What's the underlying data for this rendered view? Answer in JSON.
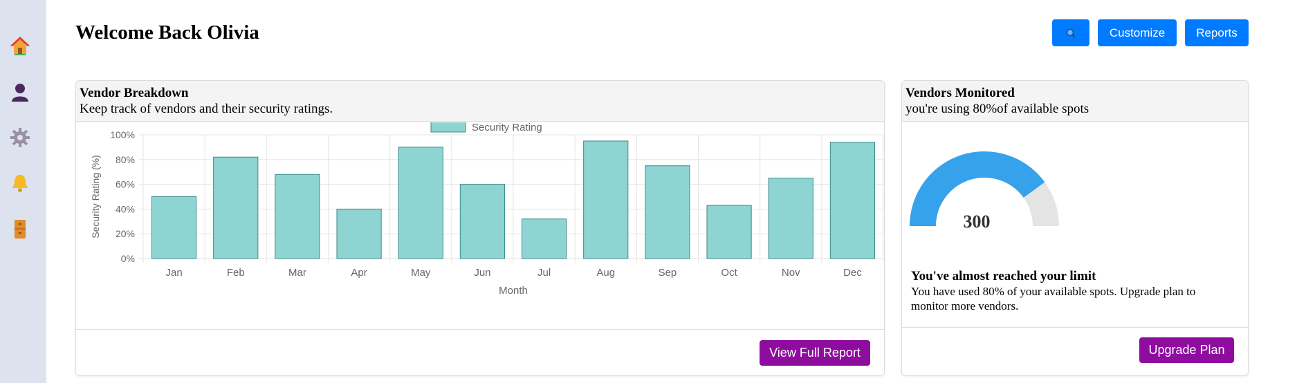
{
  "sidebar": {
    "items": [
      {
        "icon": "home-icon",
        "label": "Home"
      },
      {
        "icon": "user-icon",
        "label": "Profile"
      },
      {
        "icon": "gear-icon",
        "label": "Settings"
      },
      {
        "icon": "bell-icon",
        "label": "Notifications"
      },
      {
        "icon": "cabinet-icon",
        "label": "Archive"
      }
    ]
  },
  "header": {
    "title": "Welcome Back Olivia",
    "search_icon": "search-icon",
    "customize_label": "Customize",
    "reports_label": "Reports"
  },
  "vendor_card": {
    "title": "Vendor Breakdown",
    "subtitle": "Keep track of vendors and their security ratings.",
    "button_label": "View Full Report"
  },
  "monitor_card": {
    "title": "Vendors Monitored",
    "subtitle": "you're using 80%of available spots",
    "gauge_value": "300",
    "gauge_fraction": 0.8,
    "limit_title": "You've almost reached your limit",
    "limit_text": "You have used 80% of your available spots. Upgrade plan to monitor more vendors.",
    "button_label": "Upgrade Plan"
  },
  "colors": {
    "primary": "#007bff",
    "purple": "#8e0d9e",
    "bar_fill": "#8dd4d3",
    "bar_stroke": "#3f8a8a",
    "gauge_fill": "#36a2eb",
    "gauge_track": "#e4e4e4"
  },
  "chart_data": {
    "type": "bar",
    "categories": [
      "Jan",
      "Feb",
      "Mar",
      "Apr",
      "May",
      "Jun",
      "Jul",
      "Aug",
      "Sep",
      "Oct",
      "Nov",
      "Dec"
    ],
    "series": [
      {
        "name": "Security Rating",
        "values": [
          50,
          82,
          68,
          40,
          90,
          60,
          32,
          95,
          75,
          43,
          65,
          94
        ]
      }
    ],
    "xlabel": "Month",
    "ylabel": "Security Rating (%)",
    "ylim": [
      0,
      100
    ],
    "yticks": [
      "0%",
      "20%",
      "40%",
      "60%",
      "80%",
      "100%"
    ],
    "grid": true,
    "legend": "top"
  }
}
